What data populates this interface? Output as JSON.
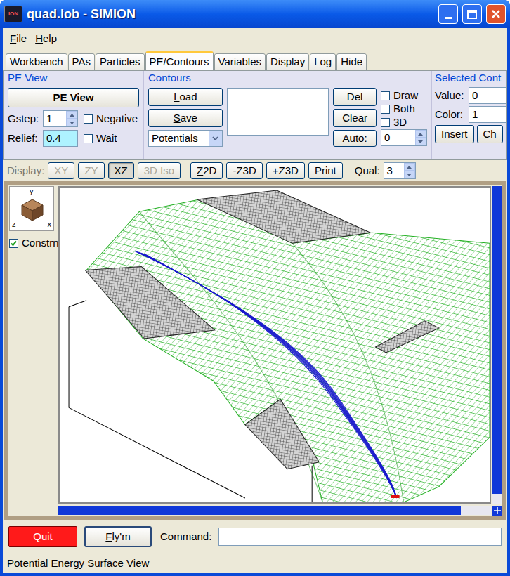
{
  "window": {
    "title": "quad.iob - SIMION",
    "icon_text": "ION"
  },
  "menu": [
    {
      "label": "File",
      "mnemonic": 0
    },
    {
      "label": "Help",
      "mnemonic": 0
    }
  ],
  "tabs": [
    {
      "label": "Workbench",
      "selected": false
    },
    {
      "label": "PAs",
      "selected": false
    },
    {
      "label": "Particles",
      "selected": false
    },
    {
      "label": "PE/Contours",
      "selected": true
    },
    {
      "label": "Variables",
      "selected": false
    },
    {
      "label": "Display",
      "selected": false
    },
    {
      "label": "Log",
      "selected": false
    },
    {
      "label": "Hide",
      "selected": false
    }
  ],
  "pe_view": {
    "title": "PE View",
    "button": "PE View",
    "gstep_label": "Gstep:",
    "gstep": "1",
    "relief_label": "Relief:",
    "relief": "0.4",
    "checkboxes": [
      {
        "label": "Negative",
        "checked": false
      },
      {
        "label": "Wait",
        "checked": false
      }
    ]
  },
  "contours": {
    "title": "Contours",
    "load": {
      "label": "Load",
      "mnemonic": 0
    },
    "save": {
      "label": "Save",
      "mnemonic": 0
    },
    "mode": "Potentials",
    "list_items": [],
    "del": {
      "label": "Del"
    },
    "clear": {
      "label": "Clear"
    },
    "auto": {
      "label": "Auto:",
      "mnemonic": 0
    },
    "checkboxes": [
      {
        "label": "Draw",
        "checked": false
      },
      {
        "label": "Both",
        "checked": false
      },
      {
        "label": "3D",
        "checked": false
      }
    ],
    "auto_value": "0"
  },
  "selected_contour": {
    "title": "Selected Cont",
    "value_label": "Value:",
    "value": "0",
    "color_label": "Color:",
    "color": "1",
    "buttons": [
      "Insert",
      "Ch"
    ]
  },
  "display_bar": {
    "label": "Display:",
    "views": [
      {
        "label": "XY",
        "disabled": true,
        "selected": false
      },
      {
        "label": "ZY",
        "disabled": true,
        "selected": false
      },
      {
        "label": "XZ",
        "disabled": false,
        "selected": true
      },
      {
        "label": "3D Iso",
        "disabled": true,
        "selected": false
      }
    ],
    "actions": [
      {
        "label": "Z2D",
        "mnemonic": 0
      },
      {
        "label": "-Z3D"
      },
      {
        "label": "+Z3D"
      },
      {
        "label": "Print"
      }
    ],
    "qual_label": "Qual:",
    "qual": "3"
  },
  "view": {
    "axes": [
      "y",
      "z",
      "x"
    ],
    "constrain": {
      "label": "Constrn",
      "checked": true
    },
    "scroll": {
      "vertical": 0.97,
      "horizontal": 0.93
    }
  },
  "bottom": {
    "quit": "Quit",
    "fly": {
      "label": "Fly'm",
      "mnemonic": 0
    },
    "command_label": "Command:",
    "command": ""
  },
  "status_bar": "Potential Energy Surface View"
}
